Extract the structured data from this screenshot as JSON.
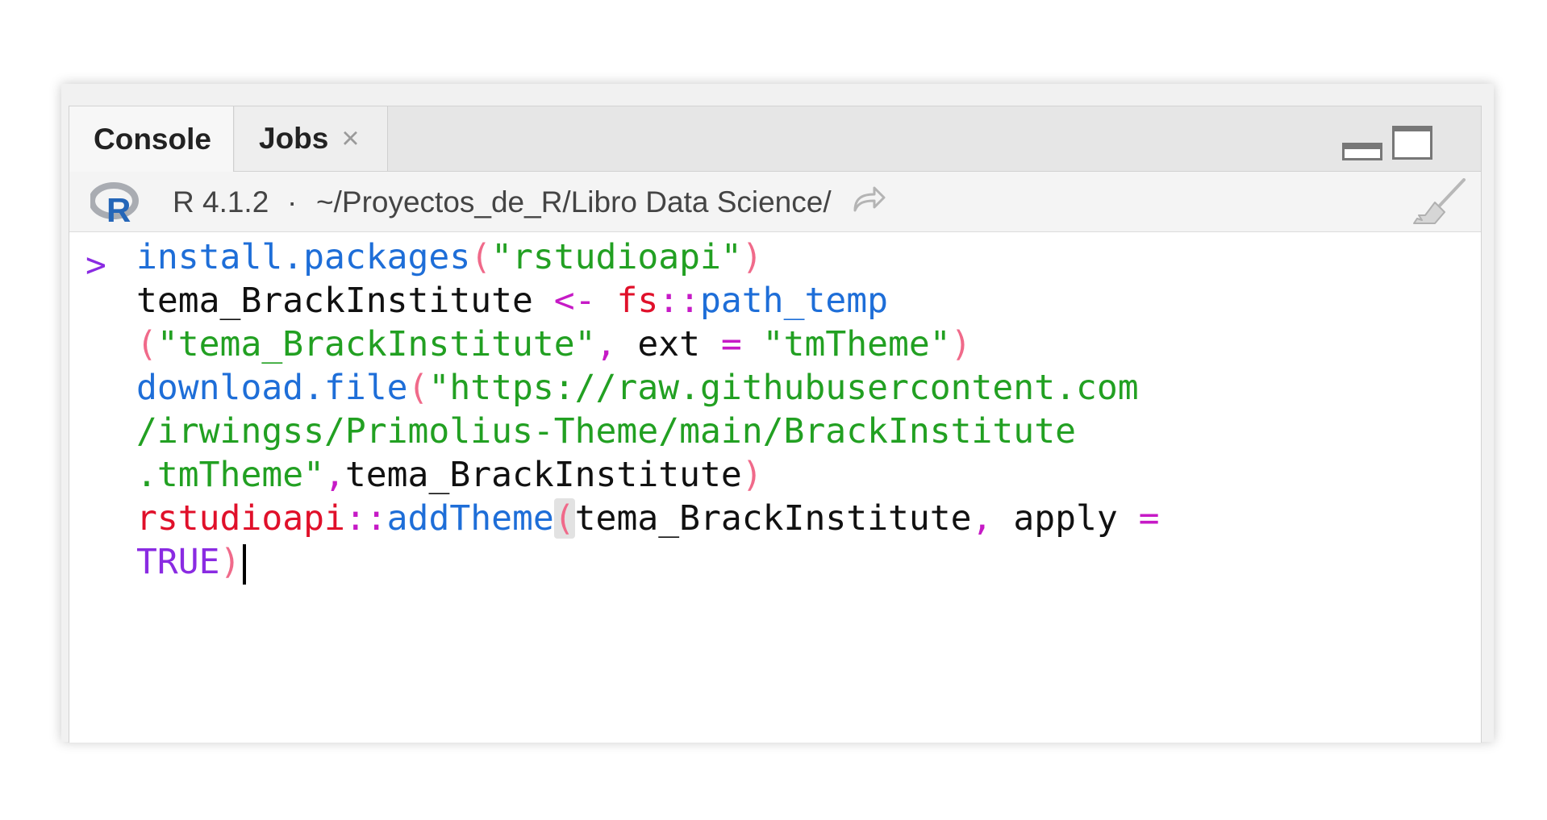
{
  "tabs": [
    {
      "label": "Console"
    },
    {
      "label": "Jobs",
      "close": "×"
    }
  ],
  "infobar": {
    "r_version": "R 4.1.2",
    "separator": "·",
    "working_dir": "~/Proyectos_de_R/Libro Data Science/"
  },
  "console": {
    "prompt": ">",
    "lines": [
      [
        "install.packages",
        "(",
        "\"rstudioapi\"",
        ")"
      ],
      [
        "tema_BrackInstitute",
        " ",
        "<-",
        " ",
        "fs",
        "::",
        "path_temp"
      ],
      [
        "(",
        "\"tema_BrackInstitute\"",
        ",",
        " ext ",
        "=",
        " ",
        "\"tmTheme\"",
        ")"
      ],
      [
        "download.file",
        "(",
        "\"https://raw.githubusercontent.com"
      ],
      [
        "/irwingss/Primolius-Theme/main/BrackInstitute"
      ],
      [
        ".tmTheme\"",
        ",",
        "tema_BrackInstitute",
        ")"
      ],
      [
        "rstudioapi",
        "::",
        "addTheme",
        "(",
        "tema_BrackInstitute",
        ",",
        " apply ",
        "="
      ],
      [
        "TRUE",
        ")"
      ]
    ]
  },
  "colors": {
    "function": "#1e6ed8",
    "string": "#22a022",
    "operator": "#c61ac6",
    "namespace": "#e0102a",
    "paren": "#f06a8a",
    "constant": "#8a2be2"
  },
  "icons": {
    "r_logo": "r-logo-icon",
    "goto_dir": "goto-directory-icon",
    "clear": "broom-icon",
    "minimize": "minimize-icon",
    "maximize": "maximize-icon"
  }
}
